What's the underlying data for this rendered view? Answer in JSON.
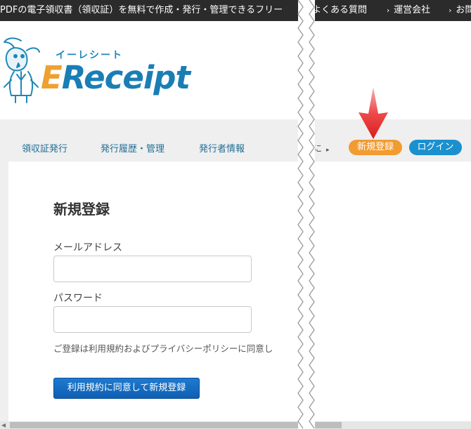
{
  "topbar": {
    "tagline": "PDFの電子領収書（領収証）を無料で作成・発行・管理できるフリー",
    "links": [
      "よくある質問",
      "運営会社",
      "お問"
    ]
  },
  "logo": {
    "kana": "イーレシート",
    "text_e": "E",
    "text_rest": "Receipt"
  },
  "nav": {
    "items": [
      "領収証発行",
      "発行履歴・管理",
      "発行者情報"
    ],
    "cut_item": "初に",
    "register": "新規登録",
    "login": "ログイン"
  },
  "form": {
    "title": "新規登録",
    "email_label": "メールアドレス",
    "email_value": "",
    "password_label": "パスワード",
    "password_value": "",
    "note": "ご登録は利用規約およびプライバシーポリシーに同意し",
    "submit": "利用規約に同意して新規登録"
  },
  "colors": {
    "accent_orange": "#f29b30",
    "accent_blue": "#1a90cf",
    "annotation_red": "#e8242a",
    "topbar_bg": "#2b2b2b"
  }
}
